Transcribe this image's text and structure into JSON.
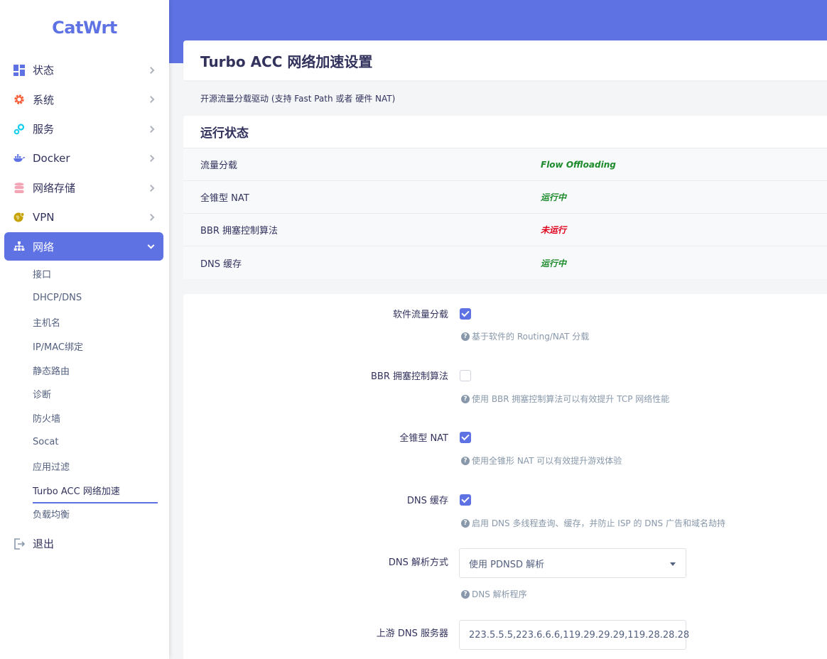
{
  "app": {
    "logo": "CatWrt"
  },
  "sidebar": {
    "items": [
      {
        "label": "状态",
        "icon": "dashboard-icon"
      },
      {
        "label": "系统",
        "icon": "gear-icon"
      },
      {
        "label": "服务",
        "icon": "services-icon"
      },
      {
        "label": "Docker",
        "icon": "docker-icon"
      },
      {
        "label": "网络存储",
        "icon": "storage-icon"
      },
      {
        "label": "VPN",
        "icon": "vpn-icon"
      },
      {
        "label": "网络",
        "icon": "network-icon"
      }
    ],
    "network_sub": [
      "接口",
      "DHCP/DNS",
      "主机名",
      "IP/MAC绑定",
      "静态路由",
      "诊断",
      "防火墙",
      "Socat",
      "应用过滤",
      "Turbo ACC 网络加速",
      "负载均衡"
    ],
    "logout": "退出"
  },
  "page": {
    "title": "Turbo ACC 网络加速设置",
    "description": "开源流量分载驱动 (支持 Fast Path 或者 硬件 NAT)"
  },
  "status": {
    "title": "运行状态",
    "rows": [
      {
        "key": "流量分载",
        "value": "Flow Offloading",
        "state": "ok"
      },
      {
        "key": "全锥型 NAT",
        "value": "运行中",
        "state": "ok"
      },
      {
        "key": "BBR 拥塞控制算法",
        "value": "未运行",
        "state": "bad"
      },
      {
        "key": "DNS 缓存",
        "value": "运行中",
        "state": "ok"
      }
    ],
    "colors": {
      "ok": "#1b8a2a",
      "bad": "#e0001b"
    }
  },
  "form": {
    "sw_offload": {
      "label": "软件流量分载",
      "checked": true,
      "help": "基于软件的 Routing/NAT 分载"
    },
    "bbr": {
      "label": "BBR 拥塞控制算法",
      "checked": false,
      "help": "使用 BBR 拥塞控制算法可以有效提升 TCP 网络性能"
    },
    "fullcone": {
      "label": "全锥型 NAT",
      "checked": true,
      "help": "使用全锥形 NAT 可以有效提升游戏体验"
    },
    "dns_cache": {
      "label": "DNS 缓存",
      "checked": true,
      "help": "启用 DNS 多线程查询、缓存，并防止 ISP 的 DNS 广告和域名劫持"
    },
    "dns_mode": {
      "label": "DNS 解析方式",
      "value": "使用 PDNSD 解析",
      "help": "DNS 解析程序"
    },
    "upstream_dns": {
      "label": "上游 DNS 服务器",
      "value": "223.5.5.5,223.6.6.6,119.29.29.29,119.28.28.28"
    }
  },
  "theme": {
    "accent": "#5e72e4"
  }
}
